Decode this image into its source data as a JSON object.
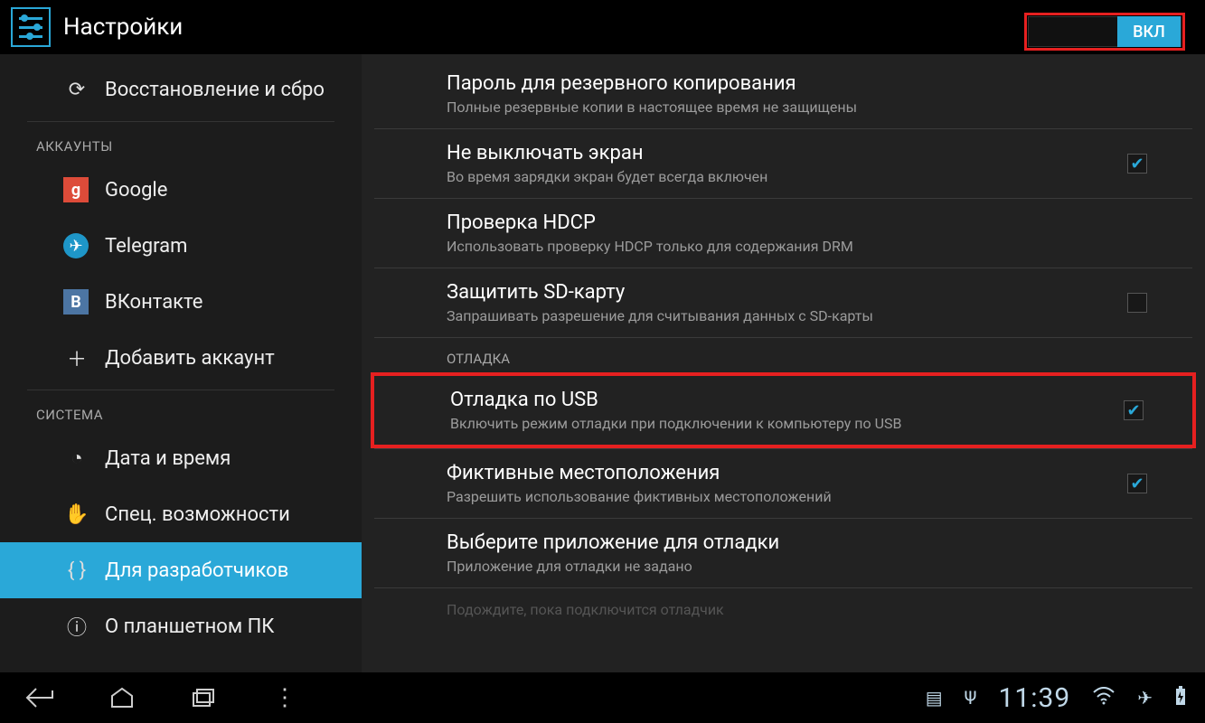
{
  "header": {
    "title": "Настройки",
    "toggle_label": "ВКЛ"
  },
  "sidebar": {
    "restore": "Восстановление и сбро",
    "section_accounts": "АККАУНТЫ",
    "google": "Google",
    "telegram": "Telegram",
    "vk": "ВКонтакте",
    "add_account": "Добавить аккаунт",
    "section_system": "СИСТЕМА",
    "datetime": "Дата и время",
    "accessibility": "Спец. возможности",
    "developer": "Для разработчиков",
    "about": "О планшетном ПК"
  },
  "content": {
    "backup_pw": {
      "t": "Пароль для резервного копирования",
      "s": "Полные резервные копии в настоящее время не защищены"
    },
    "stay_awake": {
      "t": "Не выключать экран",
      "s": "Во время зарядки экран будет всегда включен"
    },
    "hdcp": {
      "t": "Проверка HDCP",
      "s": "Использовать проверку HDCP только для содержания DRM"
    },
    "protect_sd": {
      "t": "Защитить SD-карту",
      "s": "Запрашивать разрешение для считывания данных с SD-карты"
    },
    "section_debug": "ОТЛАДКА",
    "usb_debug": {
      "t": "Отладка по USB",
      "s": "Включить режим отладки при подключении к компьютеру по USB"
    },
    "mock_loc": {
      "t": "Фиктивные местоположения",
      "s": "Разрешить использование фиктивных местоположений"
    },
    "choose_debug_app": {
      "t": "Выберите приложение для отладки",
      "s": "Приложение для отладки не задано"
    },
    "wait_debugger": {
      "s": "Подождите, пока подключится отладчик"
    }
  },
  "navbar": {
    "time": "11:39"
  }
}
